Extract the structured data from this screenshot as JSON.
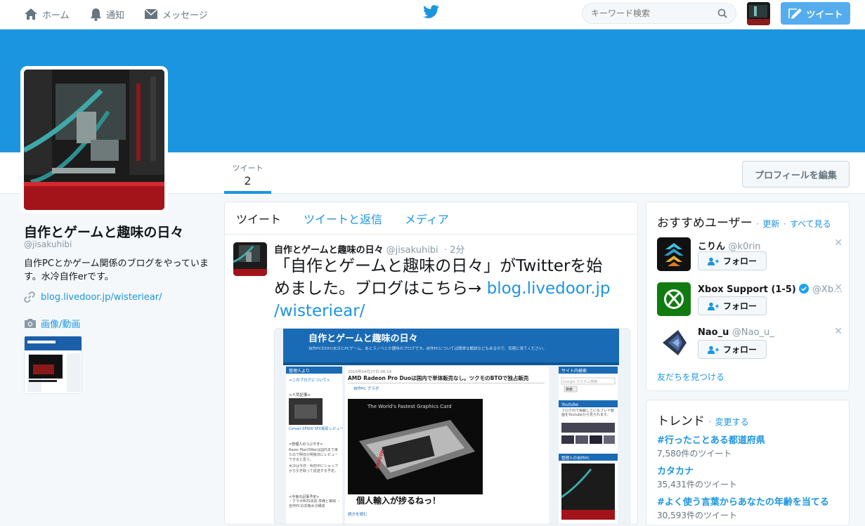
{
  "topnav": {
    "home": "ホーム",
    "notifications": "通知",
    "messages": "メッセージ"
  },
  "search": {
    "placeholder": "キーワード検索"
  },
  "tweet_button": "ツイート",
  "profile": {
    "name": "自作とゲームと趣味の日々",
    "handle": "@jisakuhibi",
    "bio": "自作PCとかゲーム関係のブログをやっています。水冷自作erです。",
    "link": "blog.livedoor.jp/wisteriear/",
    "media_label": "画像/動画"
  },
  "profile_nav": {
    "tweets_label": "ツイート",
    "tweets_count": "2",
    "edit_label": "プロフィールを編集"
  },
  "timeline": {
    "tabs": [
      "ツイート",
      "ツイートと返信",
      "メディア"
    ],
    "tweet": {
      "name": "自作とゲームと趣味の日々",
      "handle": "@jisakuhibi",
      "time": "· 2分",
      "text": "「自作とゲームと趣味の日々」がTwitterを始めました。ブログはこちら→",
      "link1": "blog.livedoor.jp",
      "link2": "/wisteriear/"
    },
    "card": {
      "site_title": "自作とゲームと趣味の日々",
      "site_desc": "自作PCのDIY/水冷とPCゲーム、あとラノベとか趣味のブログです。自作PCについては簡単な解説などもあるので、気軽に見てください。",
      "left_header": "管理人より",
      "left_link": "<このブログについて>",
      "left_item1": "<人気記事>",
      "left_product": "Corsair SF600 SFX電源 レビュー",
      "left_item2": "<管理人のつぶやき>",
      "left_text1": "Razer ManOWarは国内まで来たので明日か明後日にレビューできると思う。",
      "left_text2": "水冷は今日・明日中にショップから引き取って返送する予定。",
      "left_item3": "<今後の記事予定>",
      "left_text3": "・グラボBOS改造 準備と実践 ・自作PCの本格水冷構成",
      "post_date": "2016年04月27日 08:14",
      "post_title": "AMD Radeon Pro Duoは国内で単体販売なし。ツクモのBTOで独占販売",
      "post_tags": "自作PC グラボ",
      "graphic_caption": "The World's Fastest Graphics Card",
      "graphic_brand": "RADEON",
      "post_text": "個人輸入が捗るねっ！",
      "read_more": "続きを読む",
      "r_header1": "サイト内検索",
      "r_search_placeholder": "Google カスタム検索",
      "r_search_btn": "検索",
      "r_header2": "Youtube",
      "r_text": "ブログ内で掲載しているプレイ動画をYoutubeから見られます。",
      "r_header3": "管理人の自作PC"
    }
  },
  "who_to_follow": {
    "title": "おすすめユーザー",
    "refresh": "更新",
    "view_all": "すべて見る",
    "users": [
      {
        "name": "こりん",
        "handle": "@k0rin"
      },
      {
        "name": "Xbox Support (1-5)",
        "handle": "@Xb…"
      },
      {
        "name": "Nao_u",
        "handle": "@Nao_u_"
      }
    ],
    "follow_label": "フォロー",
    "find_friends": "友だちを見つける"
  },
  "trends": {
    "title": "トレンド",
    "change": "変更する",
    "items": [
      {
        "name": "#行ったことある都道府県",
        "count": "7,580件のツイート"
      },
      {
        "name": "カタカナ",
        "count": "35,431件のツイート"
      },
      {
        "name": "#よく使う言葉からあなたの年齢を当てる",
        "count": "30,593件のツイート"
      }
    ]
  },
  "colors": {
    "accent": "#1b95e0",
    "tweet_btn": "#55acee",
    "banner": "#1b95e0"
  }
}
